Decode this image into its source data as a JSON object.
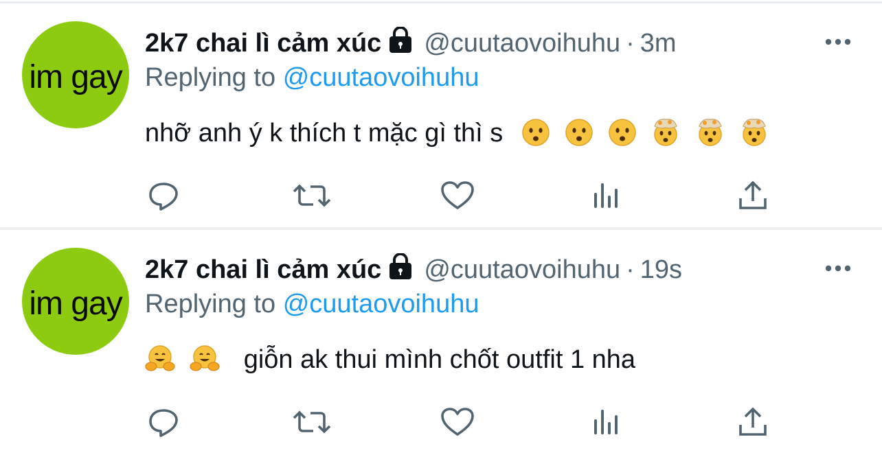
{
  "tweets": [
    {
      "avatar_text": "im gay",
      "display_name": "2k7 chai lì cảm xúc",
      "handle": "@cuutaovoihuhu",
      "separator": "·",
      "timestamp": "3m",
      "replying_prefix": "Replying to",
      "replying_to": "@cuutaovoihuhu",
      "text": "nhỡ anh ý k thích t mặc gì thì s",
      "emojis_after": [
        "frowning-face",
        "frowning-face",
        "frowning-face",
        "exploding-head",
        "exploding-head",
        "exploding-head"
      ]
    },
    {
      "avatar_text": "im gay",
      "display_name": "2k7 chai lì cảm xúc",
      "handle": "@cuutaovoihuhu",
      "separator": "·",
      "timestamp": "19s",
      "replying_prefix": "Replying to",
      "replying_to": "@cuutaovoihuhu",
      "emojis_before": [
        "hugging-face",
        "hugging-face"
      ],
      "text": "giỗn ak thui mình chốt outfit 1 nha"
    }
  ],
  "actions": [
    "reply-icon",
    "retweet-icon",
    "like-icon",
    "analytics-icon",
    "share-icon"
  ],
  "colors": {
    "avatar_bg": "#8dcb10",
    "link": "#1d9bf0",
    "secondary_text": "#536471",
    "divider": "#eceeef"
  }
}
